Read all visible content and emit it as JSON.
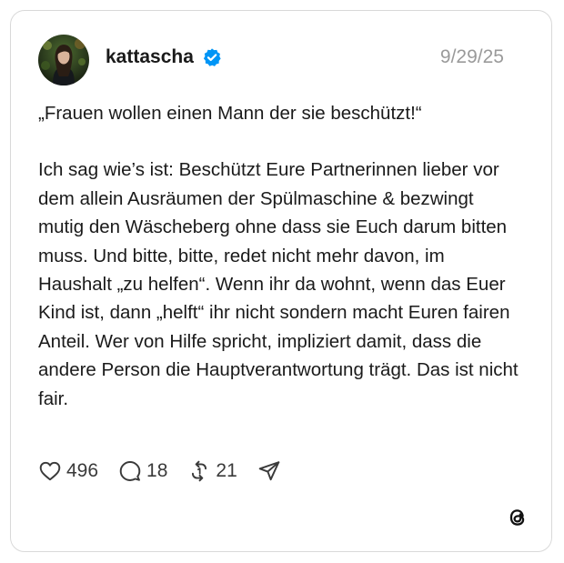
{
  "post": {
    "username": "kattascha",
    "verified": true,
    "timestamp": "9/29/25",
    "quote": "„Frauen wollen einen Mann der sie beschützt!“",
    "body": "Ich sag wie’s ist: Beschützt Eure Partnerinnen lieber vor dem allein Ausräumen der Spülmaschine & bezwingt mutig den Wäscheberg ohne dass sie Euch darum bitten muss. Und bitte, bitte, redet nicht mehr davon, im Haushalt „zu helfen“. Wenn ihr da wohnt, wenn das Euer Kind ist, dann „helft“ ihr nicht sondern macht Euren fairen Anteil. Wer von Hilfe spricht, impliziert damit, dass die andere Person die Hauptverantwortung trägt. Das ist nicht fair."
  },
  "actions": {
    "likes": "496",
    "replies": "18",
    "reposts": "21"
  },
  "icons": {
    "like": "heart-icon",
    "reply": "speech-bubble-icon",
    "repost": "repost-icon",
    "share": "paper-plane-icon",
    "verified": "verified-badge-icon",
    "brand": "threads-logo-icon"
  },
  "colors": {
    "verified_badge": "#0095f6",
    "timestamp": "#9a9a9a",
    "border": "#d9d9d9"
  }
}
